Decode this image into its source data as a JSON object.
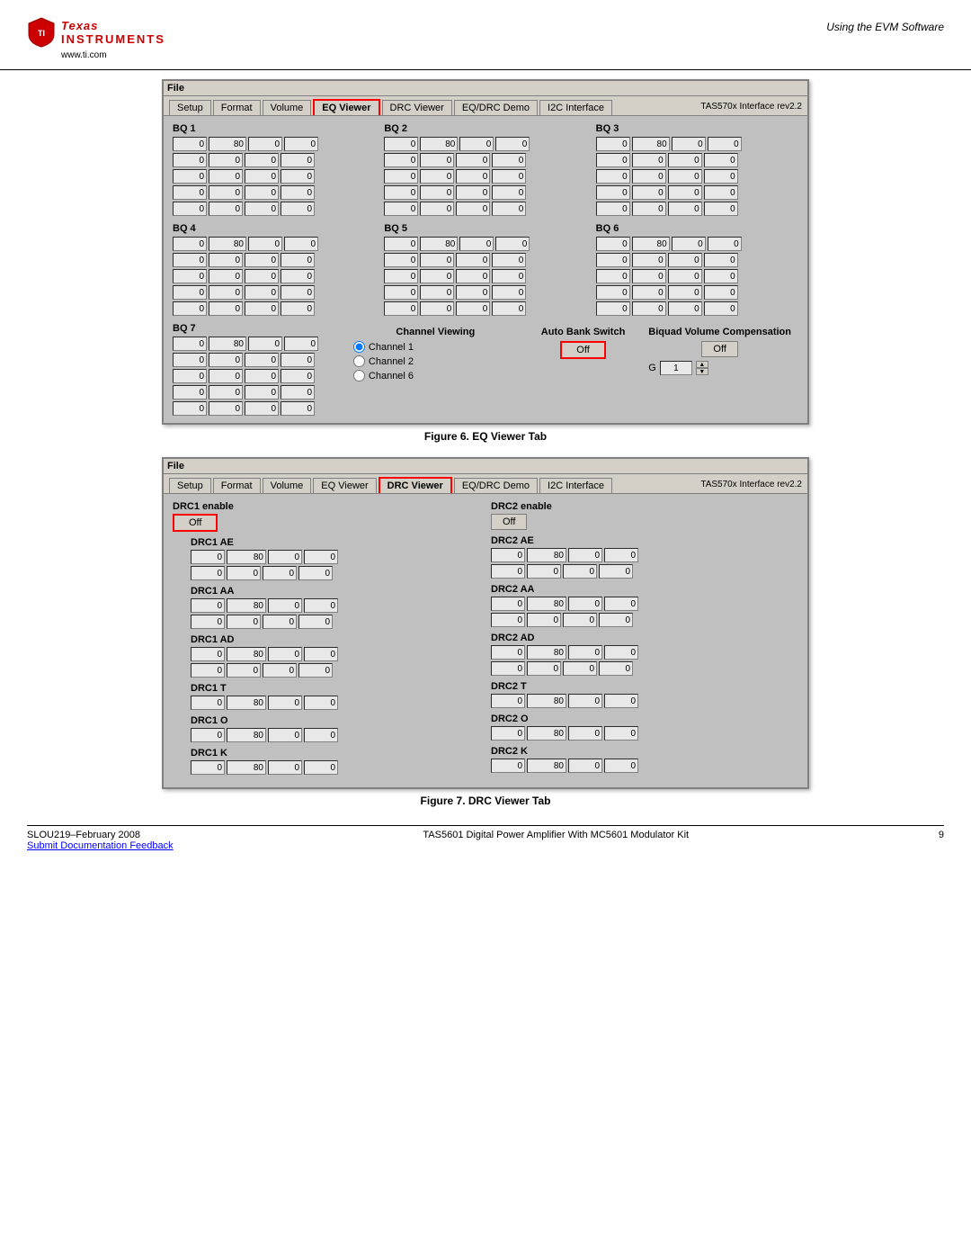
{
  "header": {
    "ti_texas": "Texas",
    "ti_instruments": "Instruments",
    "ti_url": "www.ti.com",
    "section_title": "Using the EVM Software"
  },
  "figure6": {
    "caption": "Figure 6. EQ Viewer Tab",
    "window": {
      "menu": "File",
      "tabs": [
        "Setup",
        "Format",
        "Volume",
        "EQ Viewer",
        "DRC Viewer",
        "EQ/DRC Demo",
        "I2C Interface"
      ],
      "active_tab": "EQ Viewer",
      "version": "TAS570x Interface rev2.2"
    },
    "bq1": {
      "title": "BQ 1",
      "rows": [
        [
          "0",
          "80",
          "0",
          "0"
        ],
        [
          "0",
          "0",
          "0",
          "0"
        ],
        [
          "0",
          "0",
          "0",
          "0"
        ],
        [
          "0",
          "0",
          "0",
          "0"
        ],
        [
          "0",
          "0",
          "0",
          "0"
        ]
      ]
    },
    "bq2": {
      "title": "BQ 2",
      "rows": [
        [
          "0",
          "80",
          "0",
          "0"
        ],
        [
          "0",
          "0",
          "0",
          "0"
        ],
        [
          "0",
          "0",
          "0",
          "0"
        ],
        [
          "0",
          "0",
          "0",
          "0"
        ],
        [
          "0",
          "0",
          "0",
          "0"
        ]
      ]
    },
    "bq3": {
      "title": "BQ 3",
      "rows": [
        [
          "0",
          "80",
          "0",
          "0"
        ],
        [
          "0",
          "0",
          "0",
          "0"
        ],
        [
          "0",
          "0",
          "0",
          "0"
        ],
        [
          "0",
          "0",
          "0",
          "0"
        ],
        [
          "0",
          "0",
          "0",
          "0"
        ]
      ]
    },
    "bq4": {
      "title": "BQ 4",
      "rows": [
        [
          "0",
          "80",
          "0",
          "0"
        ],
        [
          "0",
          "0",
          "0",
          "0"
        ],
        [
          "0",
          "0",
          "0",
          "0"
        ],
        [
          "0",
          "0",
          "0",
          "0"
        ],
        [
          "0",
          "0",
          "0",
          "0"
        ]
      ]
    },
    "bq5": {
      "title": "BQ 5",
      "rows": [
        [
          "0",
          "80",
          "0",
          "0"
        ],
        [
          "0",
          "0",
          "0",
          "0"
        ],
        [
          "0",
          "0",
          "0",
          "0"
        ],
        [
          "0",
          "0",
          "0",
          "0"
        ],
        [
          "0",
          "0",
          "0",
          "0"
        ]
      ]
    },
    "bq6": {
      "title": "BQ 6",
      "rows": [
        [
          "0",
          "80",
          "0",
          "0"
        ],
        [
          "0",
          "0",
          "0",
          "0"
        ],
        [
          "0",
          "0",
          "0",
          "0"
        ],
        [
          "0",
          "0",
          "0",
          "0"
        ],
        [
          "0",
          "0",
          "0",
          "0"
        ]
      ]
    },
    "bq7": {
      "title": "BQ 7",
      "rows": [
        [
          "0",
          "80",
          "0",
          "0"
        ],
        [
          "0",
          "0",
          "0",
          "0"
        ],
        [
          "0",
          "0",
          "0",
          "0"
        ],
        [
          "0",
          "0",
          "0",
          "0"
        ],
        [
          "0",
          "0",
          "0",
          "0"
        ]
      ]
    },
    "channel_viewing": {
      "title": "Channel Viewing",
      "options": [
        "Channel 1",
        "Channel 2",
        "Channel 6"
      ],
      "selected": "Channel 1"
    },
    "auto_bank_switch": {
      "title": "Auto Bank Switch",
      "button_label": "Off"
    },
    "biquad_volume": {
      "title": "Biquad Volume Compensation",
      "button_label": "Off",
      "g_label": "G",
      "g_value": "1"
    }
  },
  "figure7": {
    "caption": "Figure 7. DRC Viewer Tab",
    "window": {
      "menu": "File",
      "tabs": [
        "Setup",
        "Format",
        "Volume",
        "EQ Viewer",
        "DRC Viewer",
        "EQ/DRC Demo",
        "I2C Interface"
      ],
      "active_tab": "DRC Viewer",
      "version": "TAS570x Interface rev2.2"
    },
    "drc1_enable": {
      "label": "DRC1 enable",
      "button_label": "Off"
    },
    "drc1_ae": {
      "title": "DRC1 AE",
      "rows": [
        [
          "0",
          "80",
          "0",
          "0"
        ],
        [
          "0",
          "0",
          "0",
          "0"
        ]
      ]
    },
    "drc1_aa": {
      "title": "DRC1 AA",
      "rows": [
        [
          "0",
          "80",
          "0",
          "0"
        ],
        [
          "0",
          "0",
          "0",
          "0"
        ]
      ]
    },
    "drc1_ad": {
      "title": "DRC1 AD",
      "rows": [
        [
          "0",
          "80",
          "0",
          "0"
        ],
        [
          "0",
          "0",
          "0",
          "0"
        ]
      ]
    },
    "drc1_t": {
      "title": "DRC1 T",
      "row": [
        "0",
        "80",
        "0",
        "0"
      ]
    },
    "drc1_o": {
      "title": "DRC1 O",
      "row": [
        "0",
        "80",
        "0",
        "0"
      ]
    },
    "drc1_k": {
      "title": "DRC1 K",
      "row": [
        "0",
        "80",
        "0",
        "0"
      ]
    },
    "drc2_enable": {
      "label": "DRC2 enable",
      "button_label": "Off"
    },
    "drc2_ae": {
      "title": "DRC2 AE",
      "rows": [
        [
          "0",
          "80",
          "0",
          "0"
        ],
        [
          "0",
          "0",
          "0",
          "0"
        ]
      ]
    },
    "drc2_aa": {
      "title": "DRC2 AA",
      "rows": [
        [
          "0",
          "80",
          "0",
          "0"
        ],
        [
          "0",
          "0",
          "0",
          "0"
        ]
      ]
    },
    "drc2_ad": {
      "title": "DRC2 AD",
      "rows": [
        [
          "0",
          "80",
          "0",
          "0"
        ],
        [
          "0",
          "0",
          "0",
          "0"
        ]
      ]
    },
    "drc2_t": {
      "title": "DRC2 T",
      "row": [
        "0",
        "80",
        "0",
        "0"
      ]
    },
    "drc2_o": {
      "title": "DRC2 O",
      "row": [
        "0",
        "80",
        "0",
        "0"
      ]
    },
    "drc2_k": {
      "title": "DRC2 K",
      "row": [
        "0",
        "80",
        "0",
        "0"
      ]
    }
  },
  "footer": {
    "doc_number": "SLOU219–February 2008",
    "center_text": "TAS5601 Digital Power Amplifier With MC5601 Modulator Kit",
    "page_number": "9",
    "feedback_link": "Submit Documentation Feedback"
  }
}
